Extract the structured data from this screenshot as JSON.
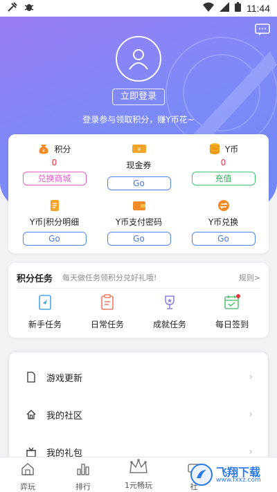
{
  "status_bar": {
    "time": "11:44"
  },
  "header": {
    "login_button": "立即登录",
    "login_hint": "登录参与领取积分，赚Y币花~"
  },
  "wallet": {
    "points": {
      "label": "积分",
      "value": "0",
      "button": "兑换商城"
    },
    "coupon": {
      "label": "现金券",
      "button": "Go"
    },
    "ycoin": {
      "label": "Y币",
      "value": "0",
      "button": "充值"
    },
    "detail": {
      "label": "Y币|积分明细",
      "button": "Go"
    },
    "paypwd": {
      "label": "Y币支付密码",
      "button": "Go"
    },
    "exchange": {
      "label": "Y币兑换",
      "button": "Go"
    }
  },
  "tasks": {
    "title": "积分任务",
    "subtitle": "每天做任务领积分兑好礼哦!",
    "rules": "规则>",
    "items": [
      {
        "label": "新手任务"
      },
      {
        "label": "日常任务"
      },
      {
        "label": "成就任务"
      },
      {
        "label": "每日签到"
      }
    ]
  },
  "menu": {
    "items": [
      {
        "label": "游戏更新"
      },
      {
        "label": "我的社区"
      },
      {
        "label": "我的礼包"
      }
    ]
  },
  "tabbar": {
    "items": [
      {
        "label": "弈玩"
      },
      {
        "label": "排行"
      },
      {
        "label": "1元畅玩"
      },
      {
        "label": "社"
      }
    ]
  },
  "watermark": {
    "text": "飞翔下载",
    "url": "www.fxxz.com"
  },
  "colors": {
    "hero_start": "#9b7cf4",
    "hero_end": "#6f88f6",
    "accent_red": "#ee3344",
    "btn_pink": "#e35bc9",
    "btn_blue": "#4d86f0",
    "btn_green": "#40c66e"
  }
}
